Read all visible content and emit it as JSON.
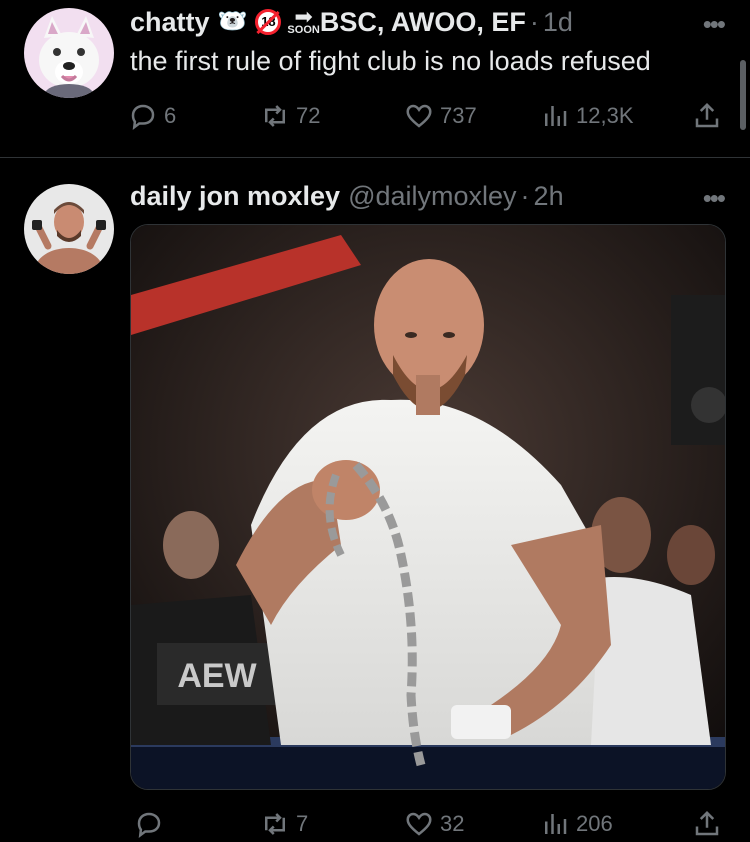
{
  "tweets": [
    {
      "author_name": "chatty",
      "emoji": "🐻‍❄️",
      "badge_18": "18",
      "soon_label": "SOON",
      "name_suffix": "BSC, AWOO, EF",
      "time": "1d",
      "text": "the first rule of fight club is no loads refused",
      "replies": "6",
      "reposts": "72",
      "likes": "737",
      "views": "12,3K",
      "avatar_icon": "white-wolf-avatar"
    },
    {
      "author_name": "daily jon moxley",
      "handle": "@dailymoxley",
      "time": "2h",
      "replies": "",
      "reposts": "7",
      "likes": "32",
      "views": "206",
      "media_logo": "AEW",
      "media_description_icon": "wrestler-with-chain-photo"
    }
  ],
  "icons": {
    "reply": "reply-icon",
    "repost": "repost-icon",
    "like": "heart-icon",
    "views": "views-icon",
    "share": "share-icon",
    "more": "more-icon"
  },
  "more_glyph": "•••",
  "colors": {
    "background": "#000000",
    "text_primary": "#e7e9ea",
    "text_secondary": "#71767b",
    "divider": "#2f3336",
    "badge_red": "#f4212e"
  }
}
